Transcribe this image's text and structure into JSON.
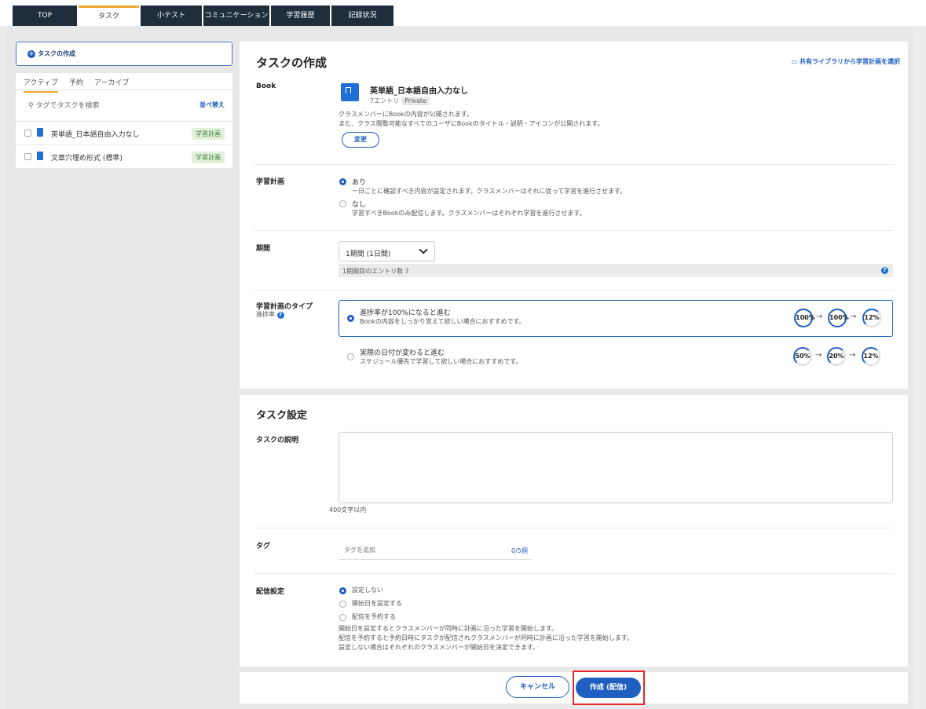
{
  "nav": {
    "tabs": [
      "TOP",
      "タスク",
      "小テスト",
      "コミュニケーション",
      "学習履歴",
      "記録状況"
    ],
    "active": "タスク"
  },
  "sidebar": {
    "create_label": "タスクの作成",
    "tabs": [
      "アクティブ",
      "予約",
      "アーカイブ"
    ],
    "search_placeholder": "タグでタスクを検索",
    "sort_label": "並べ替え",
    "items": [
      {
        "label": "英単語_日本語自由入力なし",
        "badge": "学習計画"
      },
      {
        "label": "文章穴埋め形式 (標準)",
        "badge": "学習計画"
      }
    ]
  },
  "main": {
    "title": "タスクの作成",
    "library_link": "共有ライブラリから学習計画を選択",
    "book": {
      "label": "Book",
      "title": "英単語_日本語自由入力なし",
      "entries": "7エントリ",
      "visibility": "Private",
      "note1": "クラスメンバーにBookの内容が公開されます。",
      "note2": "また、クラス閲覧可能なすべてのユーザにBookのタイトル・説明・アイコンが公開されます。",
      "change_button": "変更"
    },
    "plan": {
      "label": "学習計画",
      "yes_label": "あり",
      "yes_note": "一日ごとに確認すべき内容が設定されます。クラスメンバーはそれに従って学習を進行させます。",
      "no_label": "なし",
      "no_note": "学習すべきBookのみ配信します。クラスメンバーはそれぞれ学習を進行させます。"
    },
    "period": {
      "label": "期間",
      "selected": "1期間 (1日間)",
      "info": "1期間目のエントリ数 7"
    },
    "plan_type": {
      "label": "学習計画のタイプ",
      "sub_label": "進捗率",
      "option1_title": "進捗率が100%になると進む",
      "option1_note": "Bookの内容をしっかり覚えて欲しい場合におすすめです。",
      "option2_title": "実際の日付が変わると進む",
      "option2_note": "スケジュール優先で学習して欲しい場合におすすめです。",
      "option1_circles": [
        "100%",
        "100%",
        "12%"
      ],
      "option2_circles": [
        "50%",
        "20%",
        "12%"
      ],
      "option1_fill": [
        1.0,
        1.0,
        0.12
      ],
      "option2_fill": [
        0.5,
        0.2,
        0.12
      ]
    }
  },
  "settings": {
    "title": "タスク設定",
    "desc_label": "タスクの説明",
    "desc_limit": "400文字以内",
    "tag_label": "タグ",
    "tag_placeholder": "タグを追加",
    "tag_count": "0/5個",
    "delivery_label": "配信設定",
    "delivery_options": [
      "設定しない",
      "開始日を設定する",
      "配信を予約する"
    ],
    "delivery_note1": "開始日を設定するとクラスメンバーが同時に計画に沿った学習を開始します。",
    "delivery_note2": "配信を予約すると予約日時にタスクが配信されクラスメンバーが同時に計画に沿った学習を開始します。",
    "delivery_note3": "設定しない場合はそれぞれのクラスメンバーが開始日を決定できます。"
  },
  "footer": {
    "cancel_label": "キャンセル",
    "submit_label": "作成 (配信)"
  },
  "colors": {
    "accent": "#1f5fbf",
    "nav_dark": "#1f2d3d",
    "highlight": "#e3262a",
    "tab_accent": "#f0a830"
  }
}
